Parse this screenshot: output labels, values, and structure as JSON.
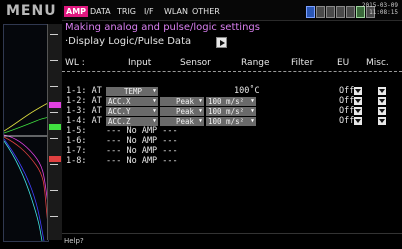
{
  "menu_label": "MENU",
  "tabs": [
    {
      "label": "AMP",
      "active": true
    },
    {
      "label": "DATA",
      "active": false
    },
    {
      "label": "TRIG",
      "active": false
    },
    {
      "label": "I/F",
      "active": false
    },
    {
      "label": "WLAN",
      "active": false
    },
    {
      "label": "OTHER",
      "active": false
    }
  ],
  "datetime": {
    "date": "2015-03-09",
    "time": "11:08:15"
  },
  "page": {
    "title": "Making analog and pulse/logic settings",
    "subtitle": "·Display Logic/Pulse Data"
  },
  "table": {
    "headers": {
      "wl": "WL :",
      "input": "Input",
      "sensor": "Sensor",
      "range": "Range",
      "filter": "Filter",
      "eu": "EU",
      "misc": "Misc."
    },
    "rows": [
      {
        "ch": "1-1: AT",
        "input": "TEMP",
        "sensor": "",
        "range": "100˚C",
        "eu": "Off"
      },
      {
        "ch": "1-2: AT",
        "input": "ACC.X",
        "sensor": "Peak",
        "range": "100 m/s²",
        "eu": "Off"
      },
      {
        "ch": "1-3: AT",
        "input": "ACC.Y",
        "sensor": "Peak",
        "range": "100 m/s²",
        "eu": "Off"
      },
      {
        "ch": "1-4: AT",
        "input": "ACC.Z",
        "sensor": "Peak",
        "range": "100 m/s²",
        "eu": "Off"
      },
      {
        "ch": "1-5:",
        "input": "--- No AMP ---"
      },
      {
        "ch": "1-6:",
        "input": "--- No AMP ---"
      },
      {
        "ch": "1-7:",
        "input": "--- No AMP ---"
      },
      {
        "ch": "1-8:",
        "input": "--- No AMP ---"
      }
    ]
  },
  "help_text": "Help?",
  "colors": {
    "accent": "#e01880",
    "title": "#d97ff0",
    "dropdown": "#6a6a6a"
  }
}
